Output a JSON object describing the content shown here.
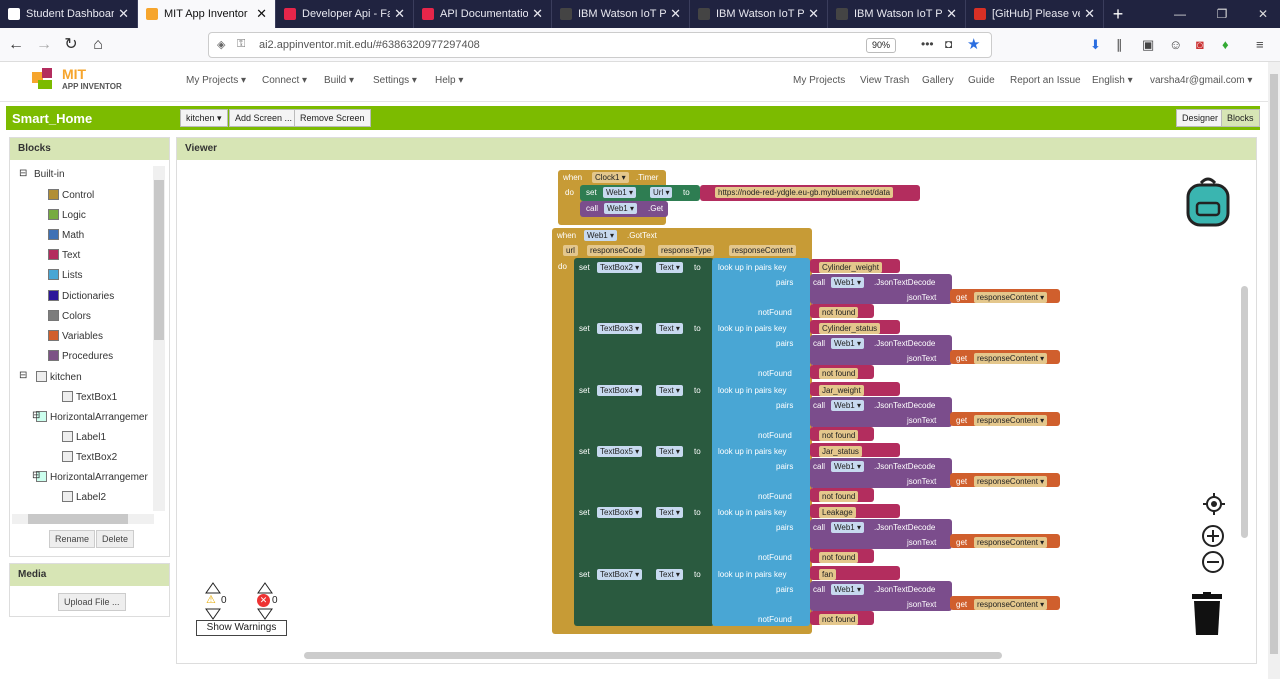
{
  "browser": {
    "tabs": [
      {
        "title": "Student Dashboard",
        "color": "#ffffff"
      },
      {
        "title": "MIT App Inventor",
        "color": "#f6a52d"
      },
      {
        "title": "Developer Api - Fa",
        "color": "#e6264a"
      },
      {
        "title": "API Documentation",
        "color": "#e6264a"
      },
      {
        "title": "IBM Watson IoT Pla",
        "color": "#444444"
      },
      {
        "title": "IBM Watson IoT Pla",
        "color": "#444444"
      },
      {
        "title": "IBM Watson IoT Pla",
        "color": "#444444"
      },
      {
        "title": "[GitHub] Please ver",
        "color": "#d93025"
      }
    ],
    "url": "ai2.appinventor.mit.edu/#6386320977297408",
    "zoom": "90%"
  },
  "app": {
    "logo_top": "MIT",
    "logo_bottom": "APP INVENTOR",
    "menu": [
      "My Projects ▾",
      "Connect ▾",
      "Build ▾",
      "Settings ▾",
      "Help ▾"
    ],
    "right_links": [
      "My Projects",
      "View Trash",
      "Gallery",
      "Guide",
      "Report an Issue",
      "English ▾",
      "varsha4r@gmail.com ▾"
    ],
    "project": "Smart_Home",
    "screen": "kitchen ▾",
    "add_screen": "Add Screen ...",
    "remove_screen": "Remove Screen",
    "designer": "Designer",
    "blocks": "Blocks"
  },
  "blocks_panel": {
    "title": "Blocks",
    "builtin": "Built-in",
    "categories": [
      {
        "name": "Control",
        "color": "#b18e35"
      },
      {
        "name": "Logic",
        "color": "#77ab41"
      },
      {
        "name": "Math",
        "color": "#3f71b5"
      },
      {
        "name": "Text",
        "color": "#b32d5e"
      },
      {
        "name": "Lists",
        "color": "#49a6d4"
      },
      {
        "name": "Dictionaries",
        "color": "#2d1799"
      },
      {
        "name": "Colors",
        "color": "#7d7d7d"
      },
      {
        "name": "Variables",
        "color": "#d05f2d"
      },
      {
        "name": "Procedures",
        "color": "#7c5385"
      }
    ],
    "components": [
      "kitchen",
      "TextBox1",
      "HorizontalArrangemer",
      "Label1",
      "TextBox2",
      "HorizontalArrangemer",
      "Label2"
    ],
    "rename": "Rename",
    "delete": "Delete"
  },
  "media": {
    "title": "Media",
    "upload": "Upload File ..."
  },
  "viewer": {
    "title": "Viewer",
    "warnings_count": "0",
    "errors_count": "0",
    "show_warnings": "Show Warnings"
  },
  "code": {
    "timer": {
      "when": "when",
      "component": "Clock1 ▾",
      "event": ".Timer",
      "do": "do",
      "set": "set",
      "web": "Web1 ▾",
      "url_prop": "Url ▾",
      "to": "to",
      "url": "https://node-red-ydgle.eu-gb.mybluemix.net/data",
      "call": "call",
      "get_method": ".Get"
    },
    "gottext": {
      "when": "when",
      "component": "Web1 ▾",
      "event": ".GotText",
      "params": [
        "url",
        "responseCode",
        "responseType",
        "responseContent"
      ],
      "do": "do"
    },
    "rows": [
      {
        "box": "TextBox2 ▾",
        "key": "Cylinder_weight"
      },
      {
        "box": "TextBox3 ▾",
        "key": "Cylinder_status"
      },
      {
        "box": "TextBox4 ▾",
        "key": "Jar_weight"
      },
      {
        "box": "TextBox5 ▾",
        "key": "Jar_status"
      },
      {
        "box": "TextBox6 ▾",
        "key": "Leakage"
      },
      {
        "box": "TextBox7 ▾",
        "key": "fan"
      }
    ],
    "labels": {
      "set": "set",
      "text_prop": "Text ▾",
      "to": "to",
      "lookup": "look up in pairs  key",
      "pairs": "pairs",
      "call": "call",
      "web": "Web1 ▾",
      "decode": ".JsonTextDecode",
      "jsontext": "jsonText",
      "get": "get",
      "resp": "responseContent ▾",
      "notfound_lbl": "notFound",
      "notfound_val": "not found"
    }
  }
}
